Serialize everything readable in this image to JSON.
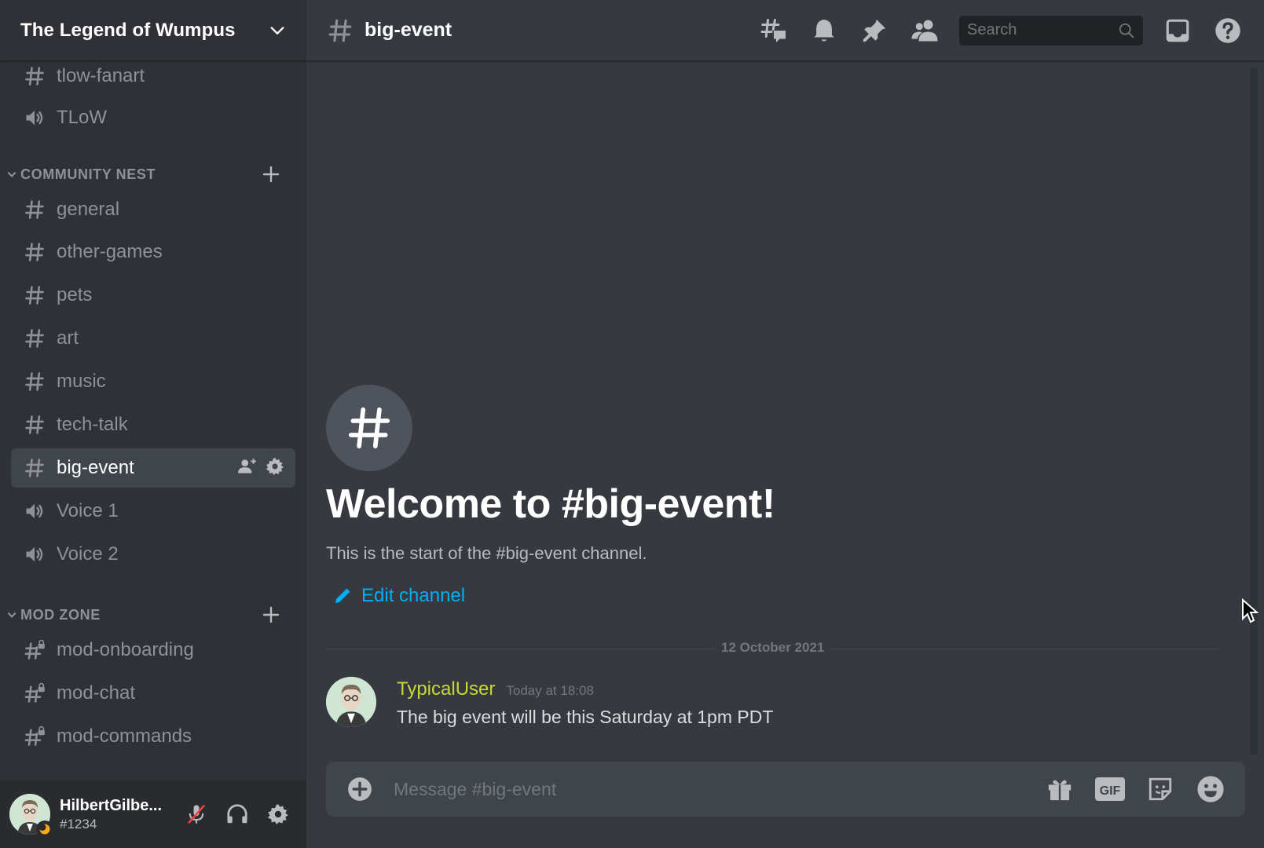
{
  "server": {
    "name": "The Legend of Wumpus"
  },
  "channels": {
    "top": [
      {
        "name": "tlow-fanart",
        "type": "text",
        "icon": "hash-icon"
      },
      {
        "name": "TLoW",
        "type": "voice",
        "icon": "speaker-icon"
      }
    ],
    "community_nest": {
      "label": "COMMUNITY NEST",
      "items": [
        {
          "name": "general",
          "type": "text"
        },
        {
          "name": "other-games",
          "type": "text"
        },
        {
          "name": "pets",
          "type": "text"
        },
        {
          "name": "art",
          "type": "text"
        },
        {
          "name": "music",
          "type": "text"
        },
        {
          "name": "tech-talk",
          "type": "text"
        },
        {
          "name": "big-event",
          "type": "text",
          "active": true
        },
        {
          "name": "Voice 1",
          "type": "voice"
        },
        {
          "name": "Voice 2",
          "type": "voice"
        }
      ]
    },
    "mod_zone": {
      "label": "MOD ZONE",
      "items": [
        {
          "name": "mod-onboarding",
          "type": "locked-text"
        },
        {
          "name": "mod-chat",
          "type": "locked-text"
        },
        {
          "name": "mod-commands",
          "type": "locked-text"
        }
      ]
    }
  },
  "user": {
    "name": "HilbertGilbe...",
    "tag": "#1234",
    "status": "idle"
  },
  "header": {
    "channel": "big-event",
    "search_placeholder": "Search",
    "icons": [
      "threads-icon",
      "bell-icon",
      "pin-icon",
      "members-icon",
      "inbox-icon",
      "help-icon"
    ]
  },
  "welcome": {
    "title": "Welcome to #big-event!",
    "subtitle": "This is the start of the #big-event channel.",
    "edit_label": "Edit channel"
  },
  "divider": {
    "date": "12 October 2021"
  },
  "messages": [
    {
      "author": "TypicalUser",
      "timestamp": "Today at 18:08",
      "text": "The big event will be this Saturday at 1pm PDT"
    }
  ],
  "composer": {
    "placeholder": "Message #big-event",
    "icons": [
      "gift-icon",
      "gif-icon",
      "sticker-icon",
      "emoji-icon"
    ],
    "gif_label": "GIF"
  },
  "colors": {
    "sidebar_bg": "#2f3136",
    "main_bg": "#36393f",
    "accent_link": "#00aff4",
    "author_color": "#c9d834"
  }
}
